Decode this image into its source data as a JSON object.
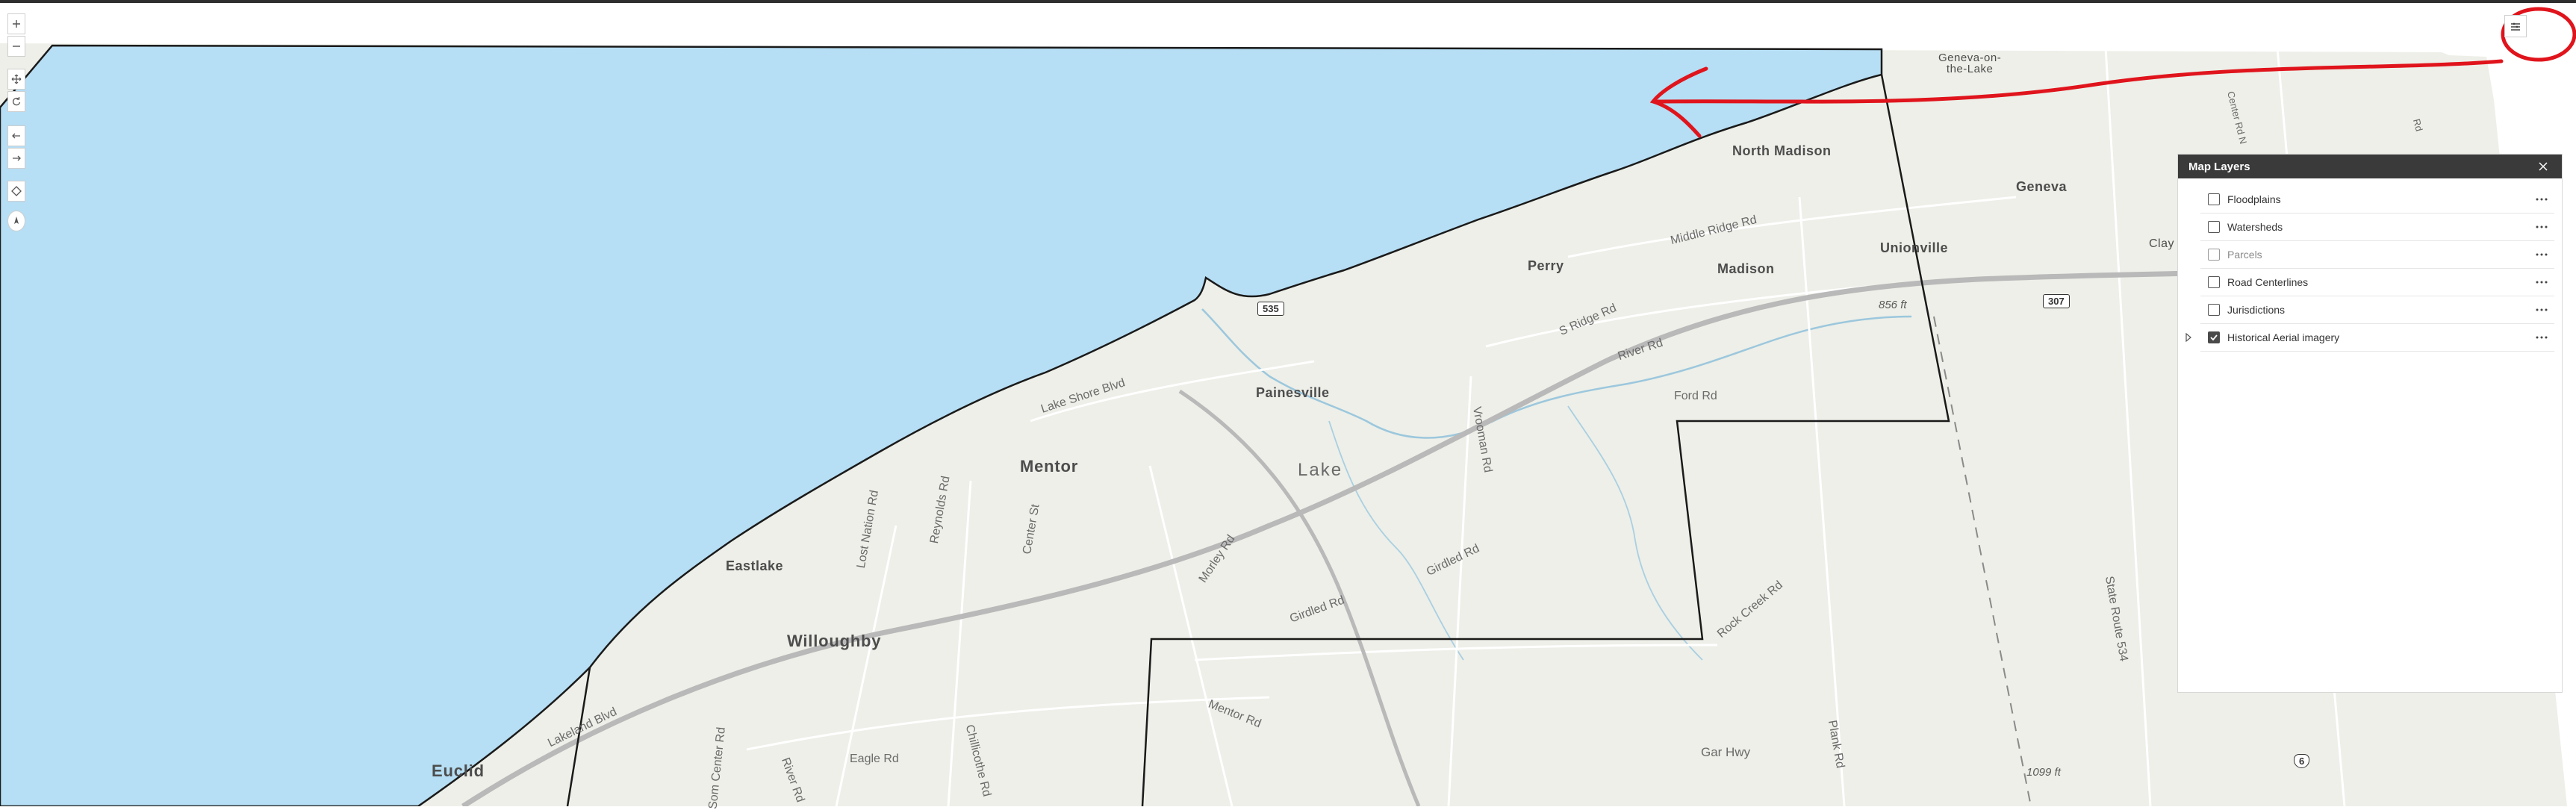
{
  "map": {
    "towns": [
      {
        "name": "Geneva-on-\nthe-Lake",
        "id": "geneva-on-the-lake"
      },
      {
        "name": "North Madison",
        "id": "north-madison"
      },
      {
        "name": "Geneva",
        "id": "geneva"
      },
      {
        "name": "Perry",
        "id": "perry"
      },
      {
        "name": "Madison",
        "id": "madison"
      },
      {
        "name": "Unionville",
        "id": "unionville"
      },
      {
        "name": "Painesville",
        "id": "painesville"
      },
      {
        "name": "Mentor",
        "id": "mentor"
      },
      {
        "name": "Eastlake",
        "id": "eastlake"
      },
      {
        "name": "Willoughby",
        "id": "willoughby"
      },
      {
        "name": "Euclid",
        "id": "euclid"
      },
      {
        "name": "Lake",
        "id": "lake"
      },
      {
        "name": "Clay",
        "id": "clay"
      }
    ],
    "roads": {
      "middle_ridge": "Middle Ridge Rd",
      "s_ridge": "S Ridge Rd",
      "river": "River Rd",
      "ford": "Ford Rd",
      "lake_shore": "Lake Shore Blvd",
      "vrooman": "Vrooman Rd",
      "lost_nation": "Lost Nation Rd",
      "reynolds": "Reynolds Rd",
      "center_st": "Center St",
      "morley": "Morley Rd",
      "girdled_1": "Girdled Rd",
      "girdled_2": "Girdled Rd",
      "rock_creek": "Rock Creek Rd",
      "mentor_rd": "Mentor Rd",
      "gar_hwy": "Gar Hwy",
      "plank": "Plank Rd",
      "sr534": "State Route 534",
      "lakeland": "Lakeland Blvd",
      "eagle": "Eagle Rd",
      "chillicothe": "Chillicothe Rd",
      "som_center": "Som Center Rd",
      "river_rd_w": "River Rd",
      "center_rd_ne": "Center Rd N",
      "rd_ne": "Rd"
    },
    "elevations": {
      "e856": "856 ft",
      "e1099": "1099 ft"
    },
    "shields": {
      "s535": "535",
      "s307": "307",
      "s6": "6"
    }
  },
  "panel": {
    "title": "Map Layers",
    "layers": [
      {
        "label": "Floodplains",
        "checked": false
      },
      {
        "label": "Watersheds",
        "checked": false
      },
      {
        "label": "Parcels",
        "checked": false
      },
      {
        "label": "Road Centerlines",
        "checked": false
      },
      {
        "label": "Jurisdictions",
        "checked": false
      },
      {
        "label": "Historical Aerial imagery",
        "checked": true
      }
    ]
  },
  "colors": {
    "water": "#b6def4",
    "land": "#edefe8",
    "boundary": "#1a1a1a",
    "highway": "#b9b9b9",
    "annotation": "#e0141c",
    "panel_header": "#3a3a3a"
  }
}
